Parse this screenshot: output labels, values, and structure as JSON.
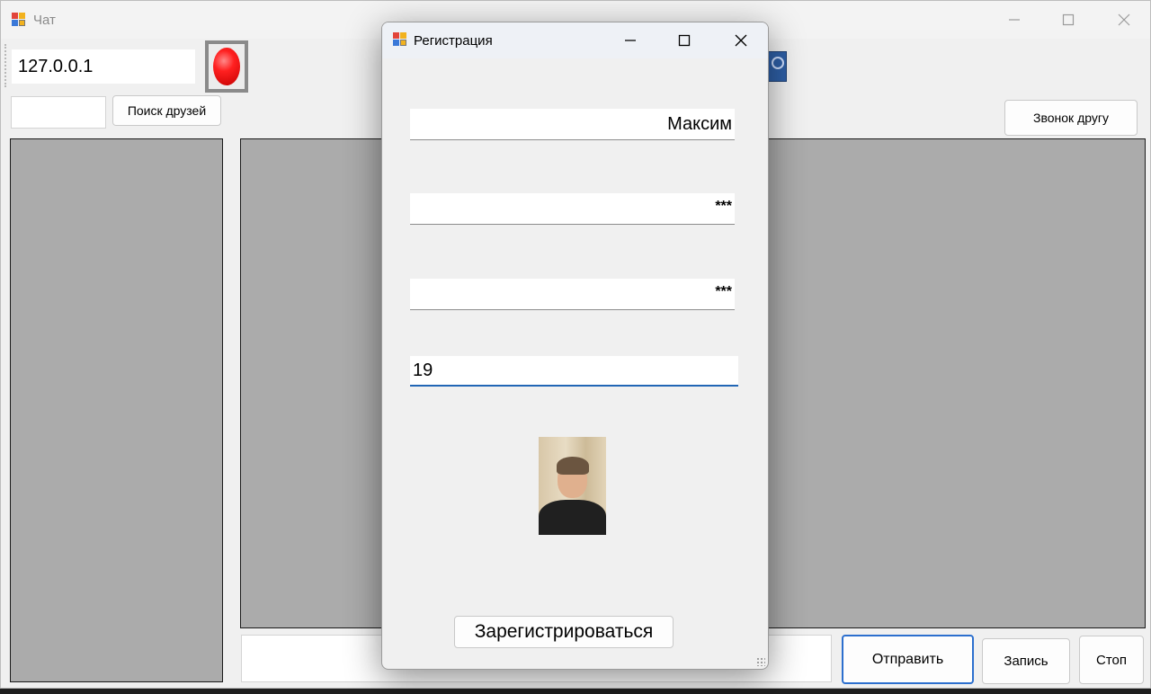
{
  "main_window": {
    "title": "Чат",
    "server_ip": "127.0.0.1",
    "status_color": "#ff2020",
    "find_friends_label": "Поиск друзей",
    "call_friend_label": "Звонок другу",
    "send_label": "Отправить",
    "record_label": "Запись",
    "stop_label": "Стоп",
    "friend_search_value": "",
    "message_value": ""
  },
  "dialog": {
    "title": "Регистрация",
    "name_value": "Максим",
    "password_value": "***",
    "password_confirm_value": "***",
    "age_value": "19",
    "register_label": "Зарегистрироваться",
    "focus_color": "#2166b5"
  }
}
